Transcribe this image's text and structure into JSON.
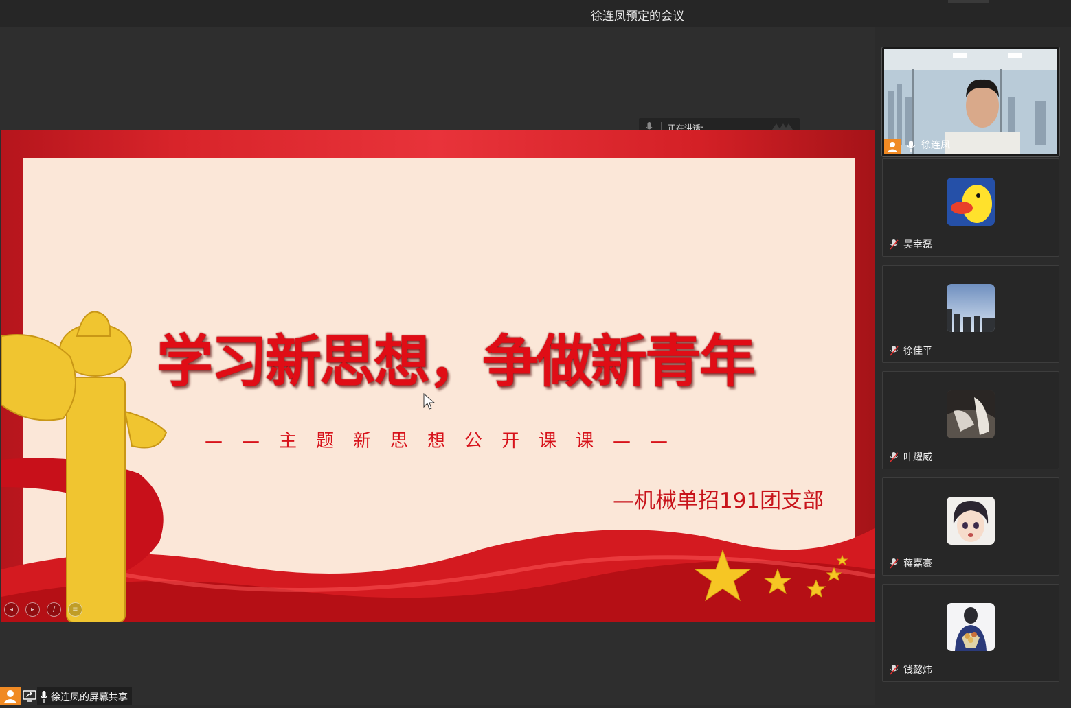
{
  "window": {
    "title": "徐连凤预定的会议"
  },
  "speaking": {
    "label": "正在讲话:"
  },
  "slide": {
    "headline": "学习新思想，争做新青年",
    "subtitle": "——主题新思想公开课课——",
    "organization": "—机械单招191团支部"
  },
  "participants": [
    {
      "name": "徐连凤",
      "active": true,
      "mic": "on"
    },
    {
      "name": "吴幸磊",
      "active": false,
      "mic": "muted",
      "avatar": "duck-avatar"
    },
    {
      "name": "徐佳平",
      "active": false,
      "mic": "muted",
      "avatar": "city-sky-avatar"
    },
    {
      "name": "叶耀威",
      "active": false,
      "mic": "muted",
      "avatar": "photo-avatar"
    },
    {
      "name": "蒋嘉豪",
      "active": false,
      "mic": "muted",
      "avatar": "anime-avatar"
    },
    {
      "name": "钱懿炜",
      "active": false,
      "mic": "muted",
      "avatar": "flowers-avatar"
    }
  ],
  "screen_share": {
    "label": "徐连凤的屏幕共享"
  },
  "colors": {
    "accent_orange": "#f08a24",
    "slide_red": "#e00d16",
    "slide_bg": "#fbe7d8"
  }
}
